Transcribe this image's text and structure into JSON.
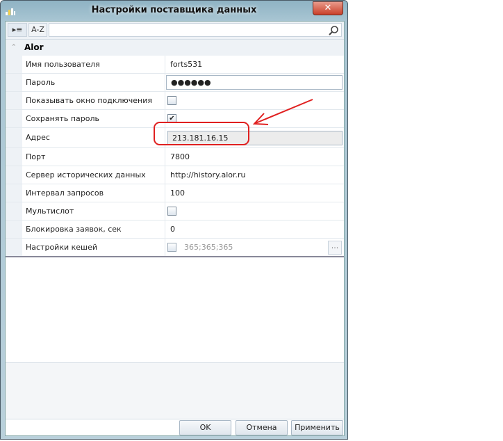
{
  "window": {
    "title": "Настройки поставщика данных",
    "close": "✕"
  },
  "toolbar": {
    "categorized": "▸≡",
    "alpha": "A-Z",
    "search_placeholder": ""
  },
  "category": {
    "name": "Alor"
  },
  "rows": [
    {
      "name": "Имя пользователя",
      "value": "forts531"
    },
    {
      "name": "Пароль",
      "value": "●●●●●●"
    },
    {
      "name": "Показывать окно подключения",
      "checked": ""
    },
    {
      "name": "Сохранять пароль",
      "checked": "✔"
    },
    {
      "name": "Адрес",
      "value": "213.181.16.15"
    },
    {
      "name": "Порт",
      "value": "7800"
    },
    {
      "name": "Сервер исторических данных",
      "value": "http://history.alor.ru"
    },
    {
      "name": "Интервал запросов",
      "value": "100"
    },
    {
      "name": "Мультислот",
      "checked": ""
    },
    {
      "name": "Блокировка заявок, сек",
      "value": "0"
    },
    {
      "name": "Настройки кешей",
      "value": "365;365;365",
      "more": "..."
    }
  ],
  "buttons": {
    "ok": "OK",
    "cancel": "Отмена",
    "apply": "Применить"
  },
  "annotation_color": "#e02020"
}
